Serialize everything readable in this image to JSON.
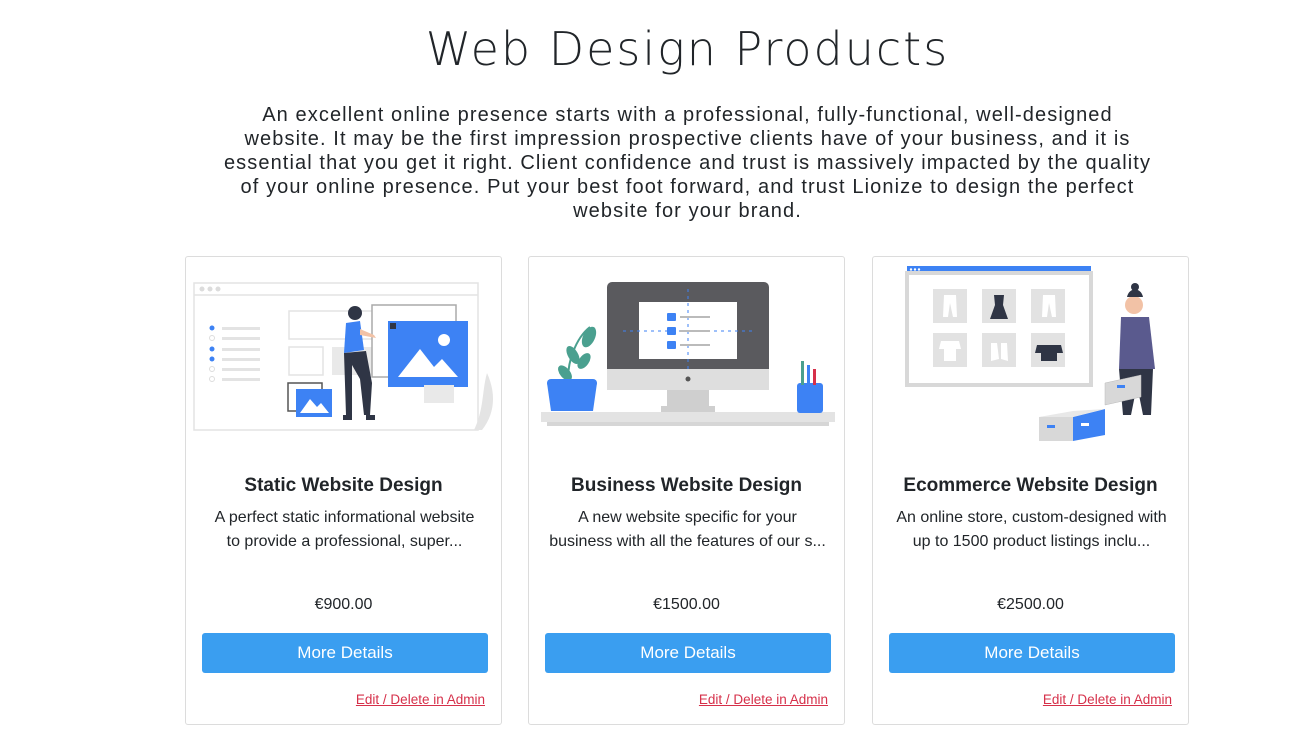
{
  "page": {
    "title": "Web Design Products",
    "intro_lines": [
      "An excellent online presence starts with a professional, fully-functional, well-designed",
      "website. It may be the first impression prospective clients have of your business, and it is",
      "essential that you get it right. Client confidence and trust is massively impacted by the quality",
      "of your online presence. Put your best foot forward, and trust Lionize to design the perfect",
      "website for your brand."
    ]
  },
  "colors": {
    "accent": "#3a9ef0",
    "admin_link": "#d6304a",
    "illustration_blue": "#3d82f4"
  },
  "products": [
    {
      "title": "Static Website Design",
      "desc_lines": [
        "A perfect static informational website",
        "to provide a professional, super..."
      ],
      "price": "€900.00",
      "button_label": "More Details",
      "admin_link": "Edit / Delete in Admin",
      "illustration": "static-website-illustration"
    },
    {
      "title": "Business Website Design",
      "desc_lines": [
        "A new website specific for your",
        "business with all the features of our s..."
      ],
      "price": "€1500.00",
      "button_label": "More Details",
      "admin_link": "Edit / Delete in Admin",
      "illustration": "business-website-illustration"
    },
    {
      "title": "Ecommerce Website Design",
      "desc_lines": [
        "An online store, custom-designed with",
        "up to 1500 product listings inclu..."
      ],
      "price": "€2500.00",
      "button_label": "More Details",
      "admin_link": "Edit / Delete in Admin",
      "illustration": "ecommerce-website-illustration"
    }
  ]
}
